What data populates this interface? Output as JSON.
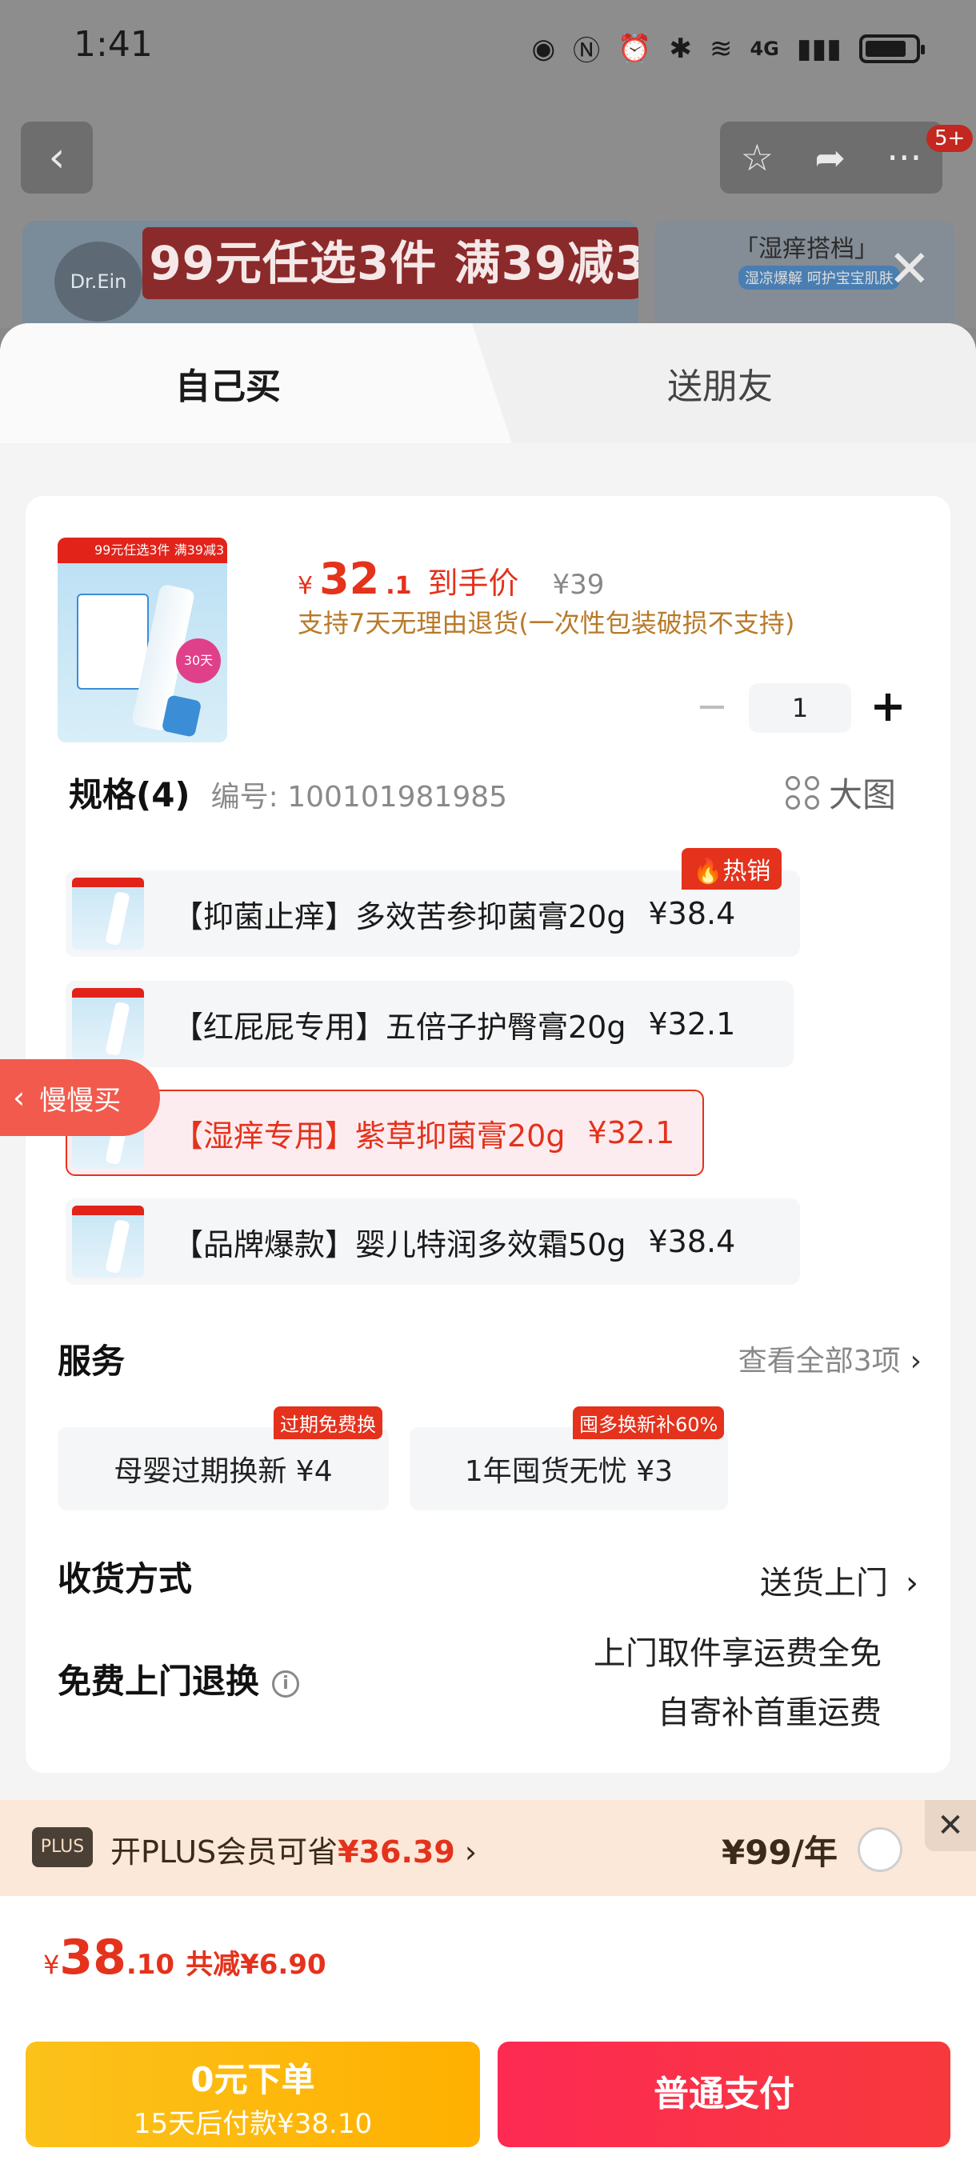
{
  "status_bar": {
    "time": "1:41",
    "network": "4G"
  },
  "top_nav": {
    "back_icon": "chevron-left-icon",
    "notification_count": "5+"
  },
  "banner": {
    "brand": "Dr.Ein",
    "promo_text": "99元任选3件 满39减3",
    "side_title": "「湿痒搭档」",
    "side_sub": "湿凉爆解 呵护宝宝肌肤"
  },
  "tabs": [
    {
      "label": "自己买"
    },
    {
      "label": "送朋友"
    }
  ],
  "product": {
    "thumb_tag": "99元任选3件 满39减3",
    "thumb_badge": "30天",
    "price_symbol": "¥",
    "price_main": "32",
    "price_decimal": ".1",
    "price_label": "到手价",
    "original_price": "¥39",
    "return_note": "支持7天无理由退货(一次性包装破损不支持)",
    "quantity": "1"
  },
  "slow_buy": {
    "label": "慢慢买"
  },
  "specs": {
    "title": "规格(4)",
    "code": "编号: 100101981985",
    "big_pic": "大图",
    "hot_badge": "热销",
    "items": [
      {
        "name": "【抑菌止痒】多效苦参抑菌膏20g",
        "price": "¥38.4"
      },
      {
        "name": "【红屁屁专用】五倍子护臀膏20g",
        "price": "¥32.1"
      },
      {
        "name": "【湿痒专用】紫草抑菌膏20g",
        "price": "¥32.1"
      },
      {
        "name": "【品牌爆款】婴儿特润多效霜50g",
        "price": "¥38.4"
      }
    ],
    "selected_index": 2
  },
  "services": {
    "title": "服务",
    "view_all": "查看全部3项",
    "items": [
      {
        "label": "母婴过期换新  ¥4",
        "tag": "过期免费换"
      },
      {
        "label": "1年囤货无忧  ¥3",
        "tag": "囤多换新补60%"
      }
    ]
  },
  "delivery": {
    "label": "收货方式",
    "value": "送货上门"
  },
  "free_return": {
    "label": "免费上门退换",
    "line1": "上门取件享运费全免",
    "line2": "自寄补首重运费"
  },
  "plus": {
    "badge": "PLUS",
    "text_prefix": "开PLUS会员可省",
    "save_amount": "¥36.39",
    "price": "¥99/年"
  },
  "total": {
    "symbol": "¥",
    "main": "38",
    "decimal": ".10",
    "discount": "共减¥6.90"
  },
  "actions": {
    "later_line1": "0元下单",
    "later_line2": "15天后付款¥38.10",
    "pay_label": "普通支付"
  },
  "colors": {
    "accent": "#e4321c",
    "pay_button": "#fd2a53",
    "later_button": "#fbc21b"
  }
}
